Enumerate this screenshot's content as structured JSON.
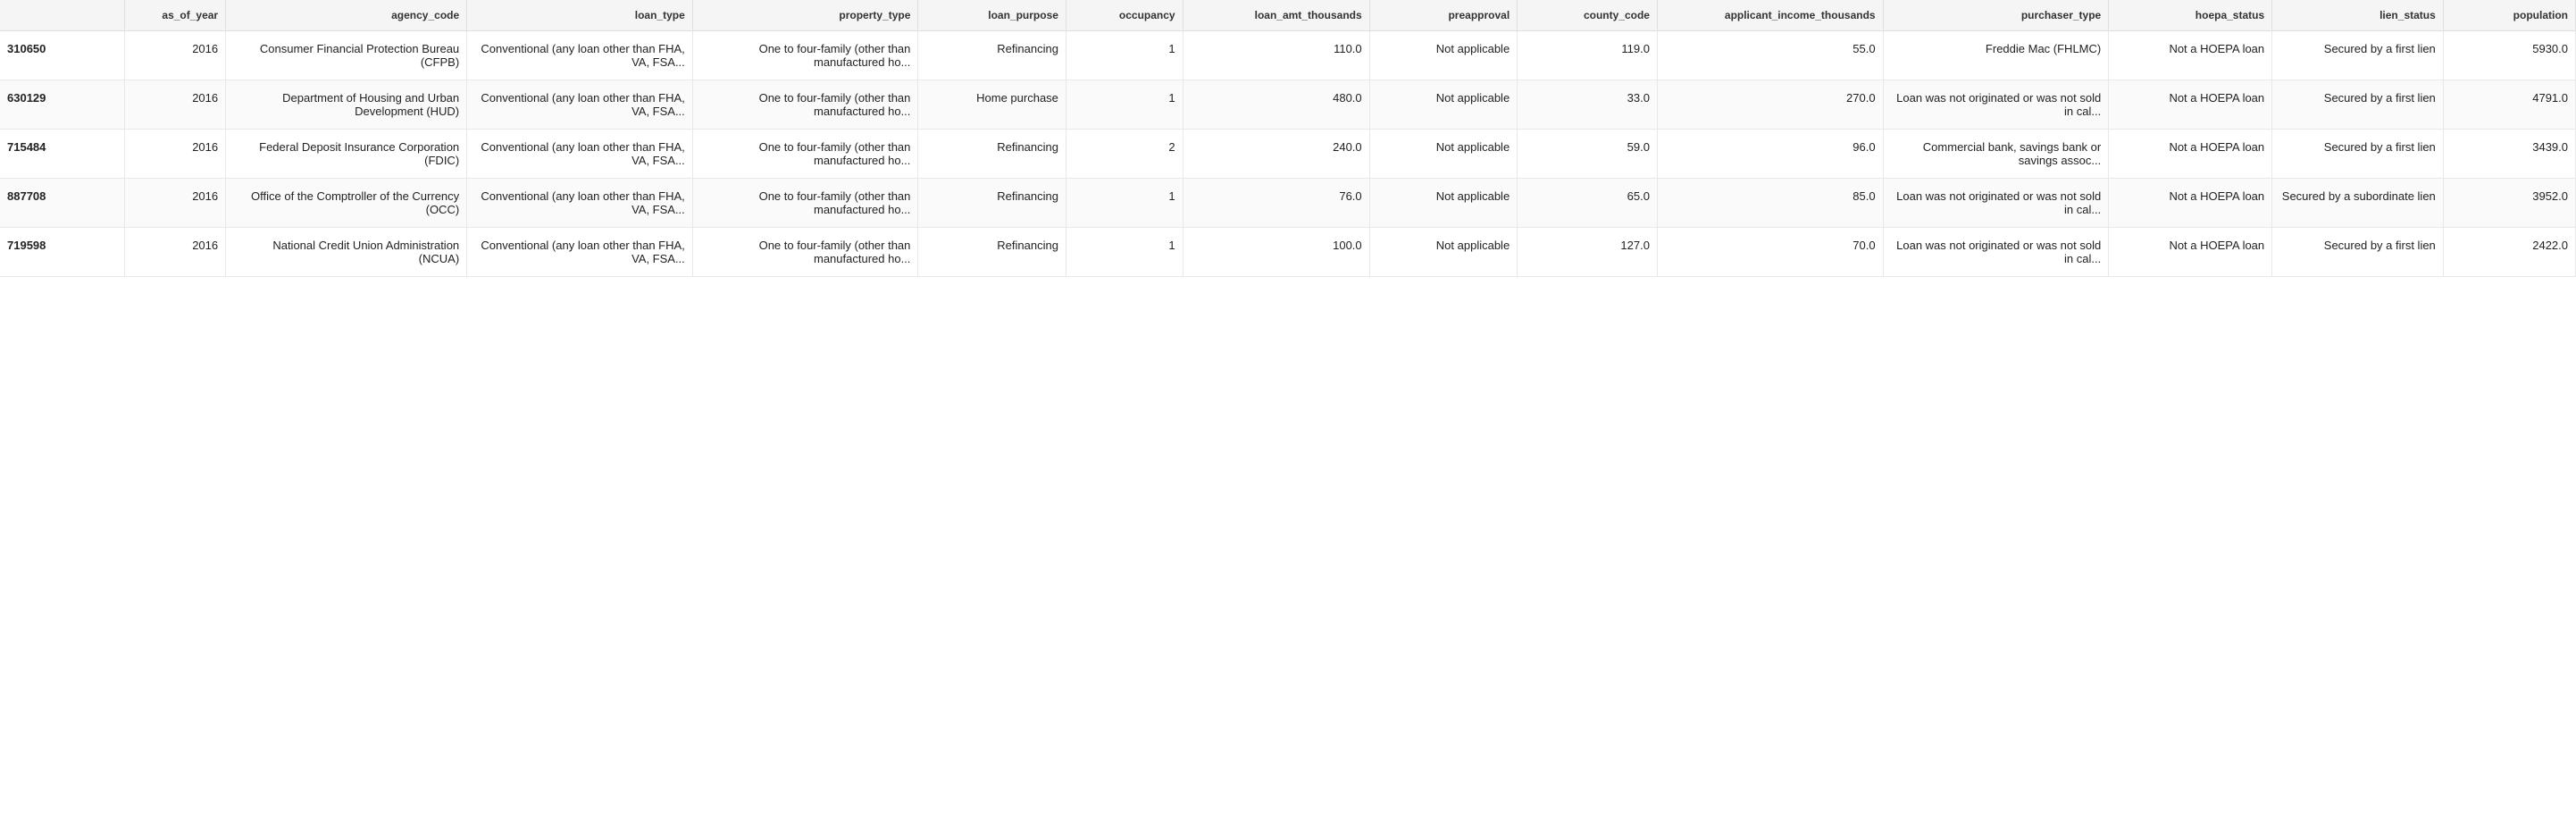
{
  "table": {
    "columns": [
      {
        "key": "index",
        "label": ""
      },
      {
        "key": "as_of_year",
        "label": "as_of_year"
      },
      {
        "key": "agency_code",
        "label": "agency_code"
      },
      {
        "key": "loan_type",
        "label": "loan_type"
      },
      {
        "key": "property_type",
        "label": "property_type"
      },
      {
        "key": "loan_purpose",
        "label": "loan_purpose"
      },
      {
        "key": "occupancy",
        "label": "occupancy"
      },
      {
        "key": "loan_amt_thousands",
        "label": "loan_amt_thousands"
      },
      {
        "key": "preapproval",
        "label": "preapproval"
      },
      {
        "key": "county_code",
        "label": "county_code"
      },
      {
        "key": "applicant_income_thousands",
        "label": "applicant_income_thousands"
      },
      {
        "key": "purchaser_type",
        "label": "purchaser_type"
      },
      {
        "key": "hoepa_status",
        "label": "hoepa_status"
      },
      {
        "key": "lien_status",
        "label": "lien_status"
      },
      {
        "key": "population",
        "label": "population"
      }
    ],
    "rows": [
      {
        "index": "310650",
        "as_of_year": "2016",
        "agency_code": "Consumer Financial Protection Bureau (CFPB)",
        "loan_type": "Conventional (any loan other than FHA, VA, FSA...",
        "property_type": "One to four-family (other than manufactured ho...",
        "loan_purpose": "Refinancing",
        "occupancy": "1",
        "loan_amt_thousands": "110.0",
        "preapproval": "Not applicable",
        "county_code": "119.0",
        "applicant_income_thousands": "55.0",
        "purchaser_type": "Freddie Mac (FHLMC)",
        "hoepa_status": "Not a HOEPA loan",
        "lien_status": "Secured by a first lien",
        "population": "5930.0"
      },
      {
        "index": "630129",
        "as_of_year": "2016",
        "agency_code": "Department of Housing and Urban Development (HUD)",
        "loan_type": "Conventional (any loan other than FHA, VA, FSA...",
        "property_type": "One to four-family (other than manufactured ho...",
        "loan_purpose": "Home purchase",
        "occupancy": "1",
        "loan_amt_thousands": "480.0",
        "preapproval": "Not applicable",
        "county_code": "33.0",
        "applicant_income_thousands": "270.0",
        "purchaser_type": "Loan was not originated or was not sold in cal...",
        "hoepa_status": "Not a HOEPA loan",
        "lien_status": "Secured by a first lien",
        "population": "4791.0"
      },
      {
        "index": "715484",
        "as_of_year": "2016",
        "agency_code": "Federal Deposit Insurance Corporation (FDIC)",
        "loan_type": "Conventional (any loan other than FHA, VA, FSA...",
        "property_type": "One to four-family (other than manufactured ho...",
        "loan_purpose": "Refinancing",
        "occupancy": "2",
        "loan_amt_thousands": "240.0",
        "preapproval": "Not applicable",
        "county_code": "59.0",
        "applicant_income_thousands": "96.0",
        "purchaser_type": "Commercial bank, savings bank or savings assoc...",
        "hoepa_status": "Not a HOEPA loan",
        "lien_status": "Secured by a first lien",
        "population": "3439.0"
      },
      {
        "index": "887708",
        "as_of_year": "2016",
        "agency_code": "Office of the Comptroller of the Currency (OCC)",
        "loan_type": "Conventional (any loan other than FHA, VA, FSA...",
        "property_type": "One to four-family (other than manufactured ho...",
        "loan_purpose": "Refinancing",
        "occupancy": "1",
        "loan_amt_thousands": "76.0",
        "preapproval": "Not applicable",
        "county_code": "65.0",
        "applicant_income_thousands": "85.0",
        "purchaser_type": "Loan was not originated or was not sold in cal...",
        "hoepa_status": "Not a HOEPA loan",
        "lien_status": "Secured by a subordinate lien",
        "population": "3952.0"
      },
      {
        "index": "719598",
        "as_of_year": "2016",
        "agency_code": "National Credit Union Administration (NCUA)",
        "loan_type": "Conventional (any loan other than FHA, VA, FSA...",
        "property_type": "One to four-family (other than manufactured ho...",
        "loan_purpose": "Refinancing",
        "occupancy": "1",
        "loan_amt_thousands": "100.0",
        "preapproval": "Not applicable",
        "county_code": "127.0",
        "applicant_income_thousands": "70.0",
        "purchaser_type": "Loan was not originated or was not sold in cal...",
        "hoepa_status": "Not a HOEPA loan",
        "lien_status": "Secured by a first lien",
        "population": "2422.0"
      }
    ]
  }
}
